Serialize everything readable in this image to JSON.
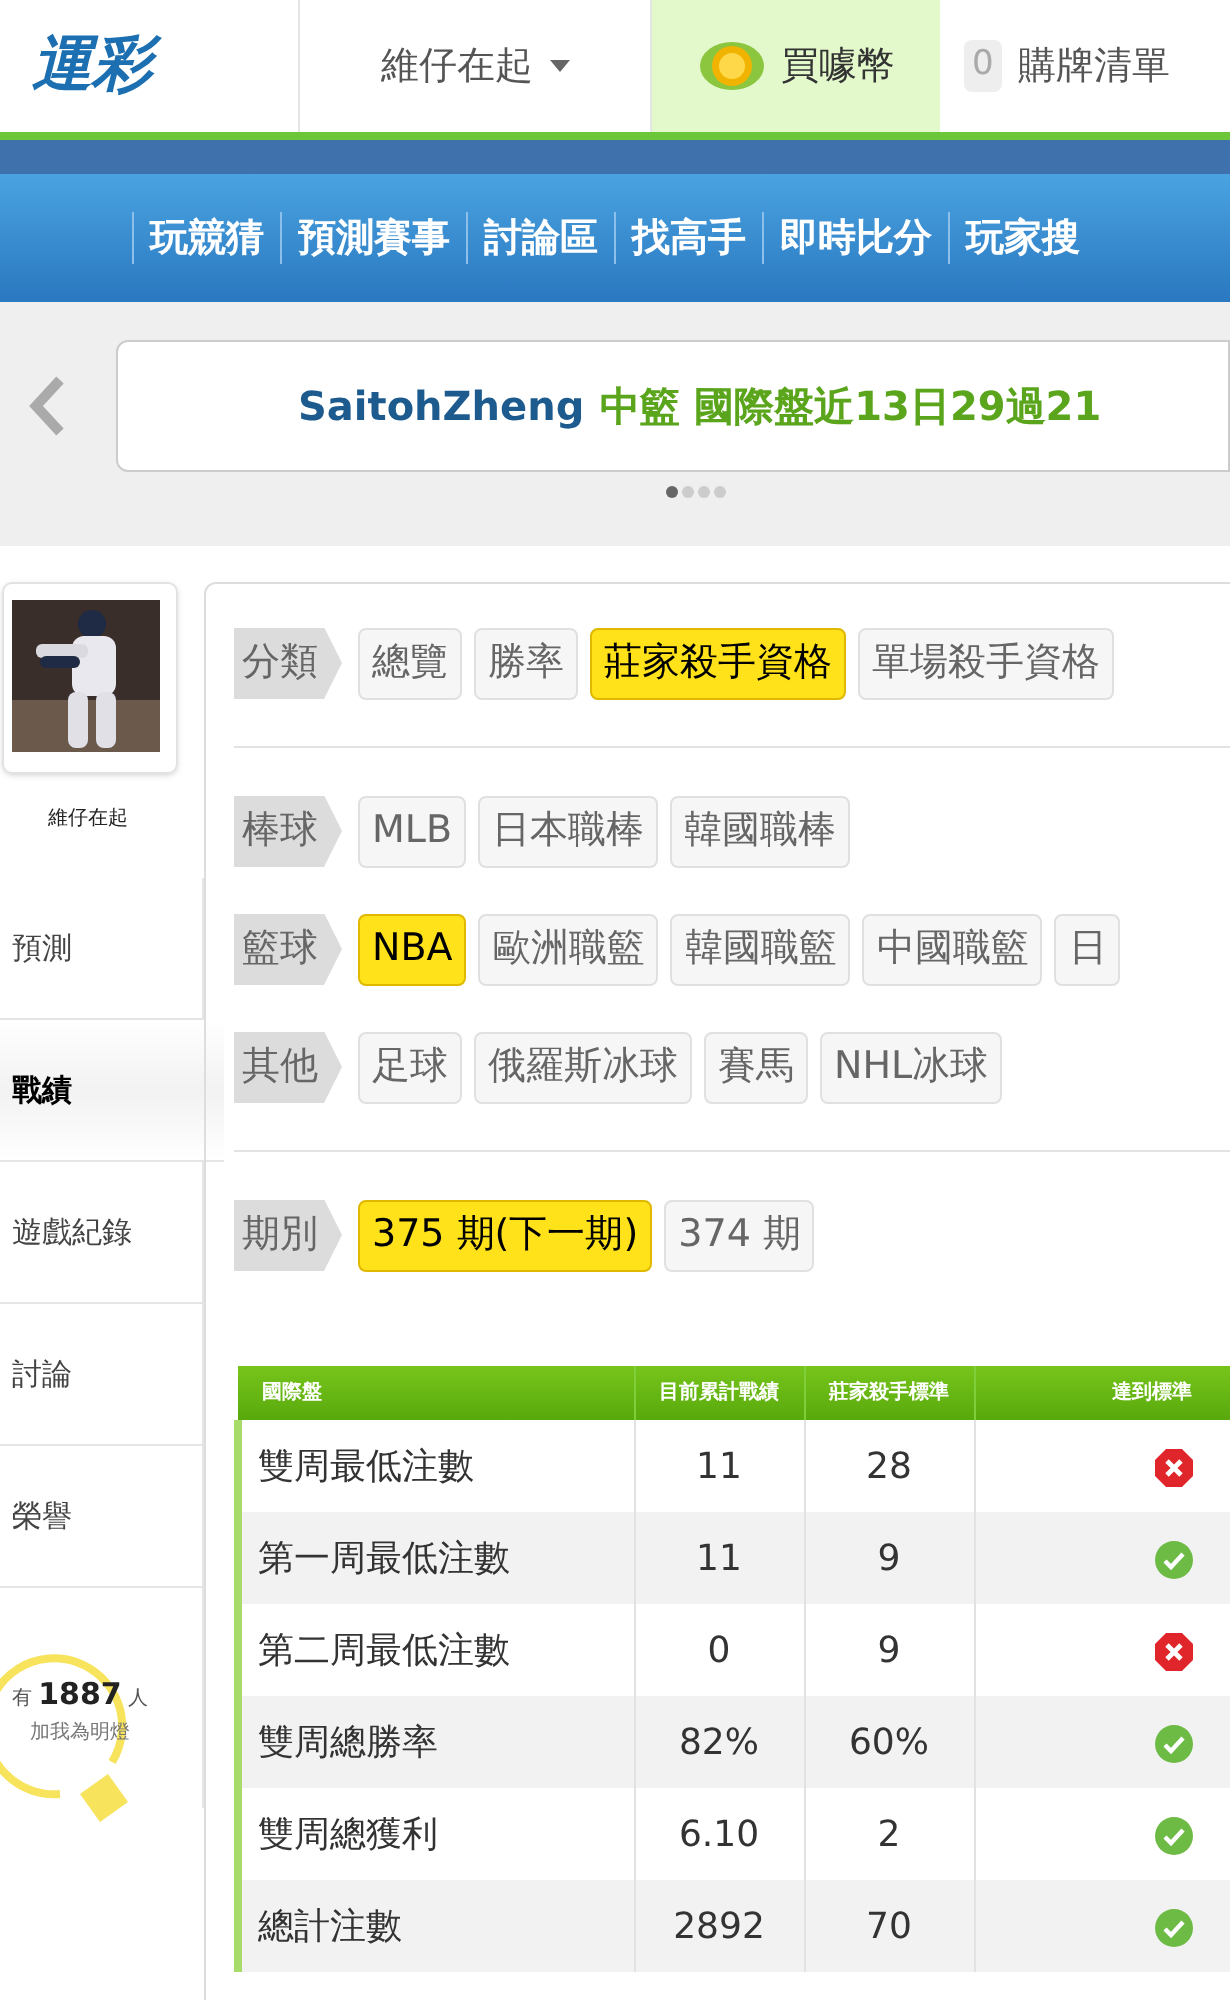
{
  "header": {
    "logo": "運彩",
    "user_menu": "維仔在起",
    "buy_coins": "買噱幣",
    "cart_count": "0",
    "cart": "購牌清單"
  },
  "nav": [
    "玩競猜",
    "預測賽事",
    "討論區",
    "找高手",
    "即時比分",
    "玩家搜"
  ],
  "banner": {
    "user": "SaitohZheng",
    "message": "中籃 國際盤近13日29過21",
    "pages": [
      {
        "selected": true
      },
      {
        "selected": false
      },
      {
        "selected": false
      },
      {
        "selected": false
      }
    ]
  },
  "sidebar": {
    "name": "維仔在起",
    "items": [
      {
        "label": "預測",
        "selected": false
      },
      {
        "label": "戰績",
        "selected": true
      },
      {
        "label": "遊戲紀錄",
        "selected": false
      },
      {
        "label": "討論",
        "selected": false
      },
      {
        "label": "榮譽",
        "selected": false
      }
    ],
    "fans": {
      "prefix": "有",
      "count": "1887",
      "suffix": "人",
      "caption": "加我為明燈"
    }
  },
  "filter_groups": [
    [
      {
        "label": "分類",
        "tags": [
          {
            "label": "總覽",
            "selected": false
          },
          {
            "label": "勝率",
            "selected": false
          },
          {
            "label": "莊家殺手資格",
            "selected": true
          },
          {
            "label": "單場殺手資格",
            "selected": false
          }
        ]
      }
    ],
    [
      {
        "label": "棒球",
        "tags": [
          {
            "label": "MLB",
            "selected": false
          },
          {
            "label": "日本職棒",
            "selected": false
          },
          {
            "label": "韓國職棒",
            "selected": false
          }
        ]
      },
      {
        "label": "籃球",
        "tags": [
          {
            "label": "NBA",
            "selected": true
          },
          {
            "label": "歐洲職籃",
            "selected": false
          },
          {
            "label": "韓國職籃",
            "selected": false
          },
          {
            "label": "中國職籃",
            "selected": false
          },
          {
            "label": "日",
            "selected": false
          }
        ]
      },
      {
        "label": "其他",
        "tags": [
          {
            "label": "足球",
            "selected": false
          },
          {
            "label": "俄羅斯冰球",
            "selected": false
          },
          {
            "label": "賽馬",
            "selected": false
          },
          {
            "label": "NHL冰球",
            "selected": false
          }
        ]
      }
    ],
    [
      {
        "label": "期別",
        "tags": [
          {
            "label": "375 期(下一期)",
            "selected": true
          },
          {
            "label": "374 期",
            "selected": false
          }
        ]
      }
    ]
  ],
  "table": {
    "columns": [
      "國際盤",
      "目前累計戰績",
      "莊家殺手標準",
      "達到標準"
    ],
    "rows": [
      {
        "item": "雙周最低注數",
        "current": "11",
        "standard": "28",
        "met": false
      },
      {
        "item": "第一周最低注數",
        "current": "11",
        "standard": "9",
        "met": true
      },
      {
        "item": "第二周最低注數",
        "current": "0",
        "standard": "9",
        "met": false
      },
      {
        "item": "雙周總勝率",
        "current": "82%",
        "standard": "60%",
        "met": true
      },
      {
        "item": "雙周總獲利",
        "current": "6.10",
        "standard": "2",
        "met": true
      },
      {
        "item": "總計注數",
        "current": "2892",
        "standard": "70",
        "met": true
      }
    ]
  }
}
